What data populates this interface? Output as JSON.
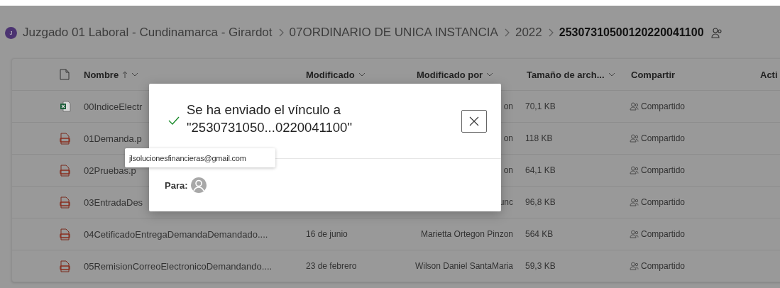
{
  "breadcrumb": {
    "avatar": "J",
    "items": [
      {
        "label": "Juzgado 01 Laboral - Cundinamarca - Girardot",
        "current": false
      },
      {
        "label": "07ORDINARIO DE UNICA INSTANCIA",
        "current": false
      },
      {
        "label": "2022",
        "current": false
      },
      {
        "label": "25307310500120220041100",
        "current": true
      }
    ]
  },
  "table": {
    "columns": [
      {
        "label": "Nombre",
        "sorted": true,
        "menu": true
      },
      {
        "label": "Modificado",
        "sorted": false,
        "menu": true
      },
      {
        "label": "Modificado por",
        "sorted": false,
        "menu": true
      },
      {
        "label": "Tamaño de arch...",
        "sorted": false,
        "menu": true
      },
      {
        "label": "Compartir",
        "sorted": false,
        "menu": false
      },
      {
        "label": "Acti",
        "sorted": false,
        "menu": false
      }
    ],
    "rows": [
      {
        "kind": "excel",
        "name": "00IndiceElectr",
        "modified_by": "on",
        "size": "70,1 KB",
        "sharing": "Compartido"
      },
      {
        "kind": "pdf",
        "name": "01Demanda.p",
        "modified_by": "on",
        "size": "118 KB",
        "sharing": "Compartido"
      },
      {
        "kind": "pdf",
        "name": "02Pruebas.p",
        "modified_by": "on",
        "size": "64,1 KB",
        "sharing": "Compartido"
      },
      {
        "kind": "pdf",
        "name": "03EntradaDes",
        "modified_by": "unc",
        "size": "96,8 KB",
        "sharing": "Compartido"
      },
      {
        "kind": "pdf",
        "name": "04CetificadoEntregaDemandaDemandado....",
        "modified": "16 de junio",
        "modified_by": "Marietta Ortegon Pinzon",
        "size": "564 KB",
        "sharing": "Compartido"
      },
      {
        "kind": "pdf",
        "name": "05RemisionCorreoElectronicoDemandando....",
        "modified": "23 de febrero",
        "modified_by": "Wilson Daniel SantaMaria",
        "size": "59,3 KB",
        "sharing": "Compartido"
      }
    ]
  },
  "dialog": {
    "title": "Se ha enviado el vínculo a \"2530731050...0220041100\"",
    "to_label": "Para:",
    "tooltip": "jlsolucionesfinancieras@gmail.com"
  }
}
